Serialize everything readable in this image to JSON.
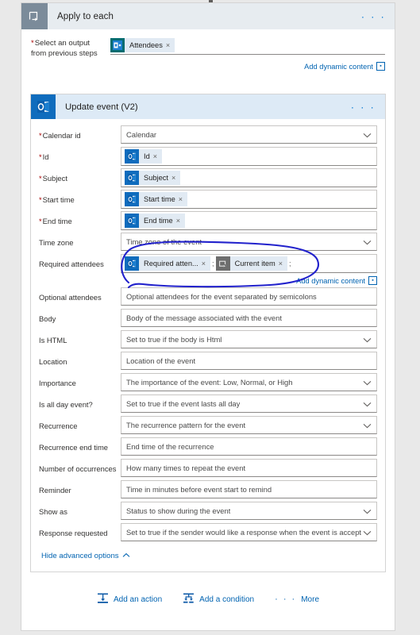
{
  "loop": {
    "title": "Apply to each",
    "icon": "foreach-loop-icon",
    "menu": "· · ·",
    "select_output": {
      "label_line1": "Select an output",
      "label_line2": "from previous steps",
      "required": true,
      "tokens": [
        {
          "text": "Attendees",
          "icon": "sharepoint-icon",
          "remove": "×"
        }
      ]
    },
    "add_dynamic_content": {
      "text": "Add dynamic content",
      "button_glyph": "▪"
    }
  },
  "action": {
    "title": "Update event (V2)",
    "icon": "outlook-icon",
    "menu": "· · ·",
    "fields": [
      {
        "label": "Calendar id",
        "required": true,
        "type": "dropdown",
        "value": "Calendar",
        "tokens": []
      },
      {
        "label": "Id",
        "required": true,
        "type": "tokens",
        "value": "",
        "tokens": [
          {
            "text": "Id",
            "icon": "outlook-icon",
            "remove": "×"
          }
        ]
      },
      {
        "label": "Subject",
        "required": true,
        "type": "tokens",
        "value": "",
        "tokens": [
          {
            "text": "Subject",
            "icon": "outlook-icon",
            "remove": "×"
          }
        ]
      },
      {
        "label": "Start time",
        "required": true,
        "type": "tokens",
        "value": "",
        "tokens": [
          {
            "text": "Start time",
            "icon": "outlook-icon",
            "remove": "×"
          }
        ]
      },
      {
        "label": "End time",
        "required": true,
        "type": "tokens",
        "value": "",
        "tokens": [
          {
            "text": "End time",
            "icon": "outlook-icon",
            "remove": "×"
          }
        ]
      },
      {
        "label": "Time zone",
        "required": false,
        "type": "dropdown",
        "value": "Time zone of the event",
        "tokens": []
      }
    ],
    "required_attendees": {
      "label": "Required attendees",
      "required": false,
      "tokens": [
        {
          "text": "Required atten...",
          "icon": "outlook-icon",
          "remove": "×",
          "trailing": ";"
        },
        {
          "text": "Current item",
          "icon": "current-item-icon",
          "remove": "×",
          "trailing": ";"
        }
      ],
      "add_dynamic_content": {
        "text": "Add dynamic content",
        "button_glyph": "▪"
      }
    },
    "fields_after": [
      {
        "label": "Optional attendees",
        "required": false,
        "type": "text",
        "value": "Optional attendees for the event separated by semicolons"
      },
      {
        "label": "Body",
        "required": false,
        "type": "text",
        "value": "Body of the message associated with the event"
      },
      {
        "label": "Is HTML",
        "required": false,
        "type": "dropdown",
        "value": "Set to true if the body is Html"
      },
      {
        "label": "Location",
        "required": false,
        "type": "text",
        "value": "Location of the event"
      },
      {
        "label": "Importance",
        "required": false,
        "type": "dropdown",
        "value": "The importance of the event: Low, Normal, or High"
      },
      {
        "label": "Is all day event?",
        "required": false,
        "type": "dropdown",
        "value": "Set to true if the event lasts all day"
      },
      {
        "label": "Recurrence",
        "required": false,
        "type": "dropdown",
        "value": "The recurrence pattern for the event"
      },
      {
        "label": "Recurrence end time",
        "required": false,
        "type": "text",
        "value": "End time of the recurrence"
      },
      {
        "label": "Number of occurrences",
        "required": false,
        "type": "text",
        "value": "How many times to repeat the event"
      },
      {
        "label": "Reminder",
        "required": false,
        "type": "text",
        "value": "Time in minutes before event start to remind"
      },
      {
        "label": "Show as",
        "required": false,
        "type": "dropdown",
        "value": "Status to show during the event"
      },
      {
        "label": "Response requested",
        "required": false,
        "type": "dropdown",
        "value": "Set to true if the sender would like a response when the event is accept"
      }
    ],
    "hide_advanced": {
      "text": "Hide advanced options",
      "icon": "chevron-up-icon"
    }
  },
  "bottom_bar": {
    "add_action": {
      "text": "Add an action",
      "icon": "add-action-icon"
    },
    "add_condition": {
      "text": "Add a condition",
      "icon": "add-condition-icon"
    },
    "more": {
      "text": "More",
      "dots": "· · ·"
    }
  },
  "annotation": {
    "shape": "hand-drawn-ellipse",
    "color": "#2222cc"
  },
  "colors": {
    "loop_header_bg": "#e7ecf0",
    "loop_icon_bg": "#7b8b9a",
    "action_header_bg": "#ddeaf6",
    "action_icon_bg": "#0f6cbd",
    "token_bg": "#e1eaf3",
    "link": "#0063b1",
    "required_star": "#a80000",
    "page_bg": "#e9e9e9"
  }
}
